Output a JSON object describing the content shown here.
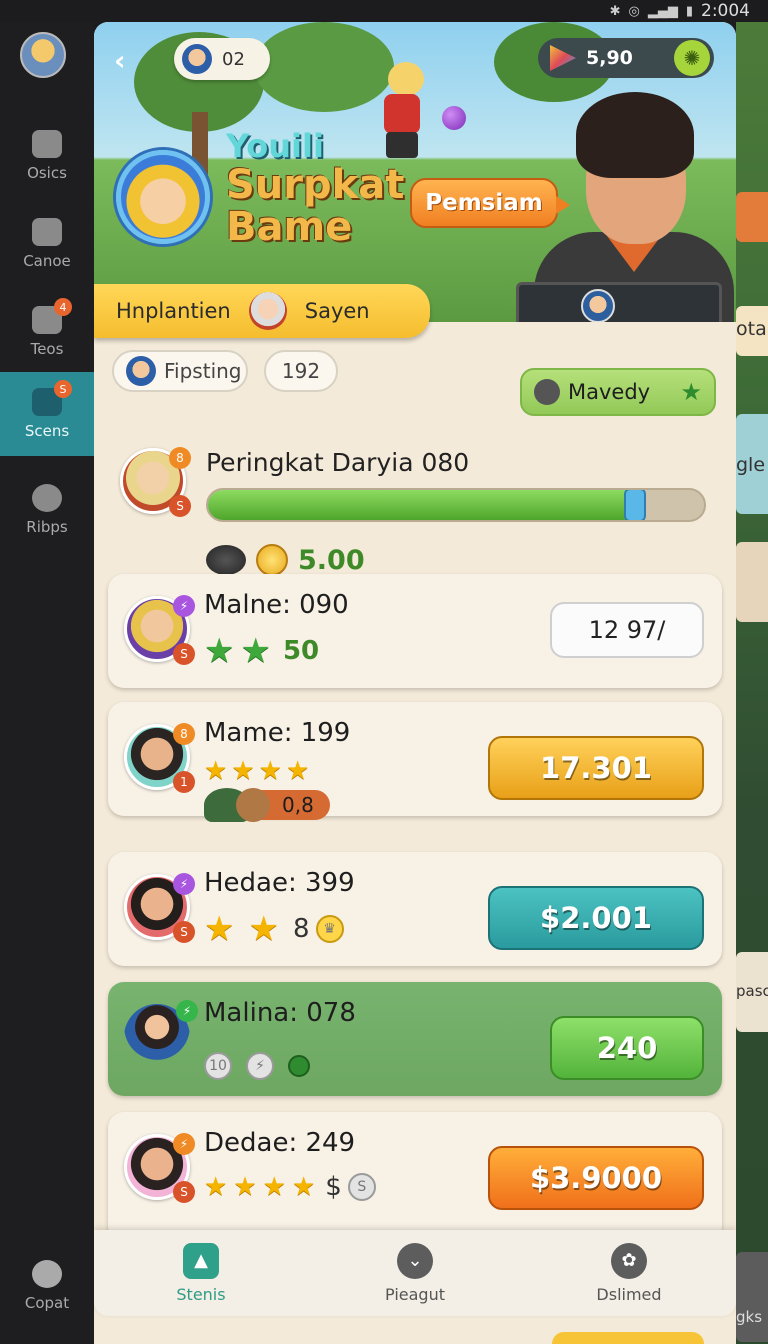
{
  "status_bar": {
    "time": "2:004"
  },
  "rail": {
    "items": [
      {
        "label": "Osics"
      },
      {
        "label": "Canoe"
      },
      {
        "label": "Teos",
        "badge": "4"
      },
      {
        "label": "Scens",
        "badge": "S",
        "active": true
      },
      {
        "label": "Ribps"
      }
    ],
    "bottom_label": "Copat"
  },
  "right_edge": {
    "fragments": [
      "otar",
      "gle",
      "pasc",
      "gks"
    ]
  },
  "hero": {
    "pill_count": "02",
    "coins": "5,90",
    "title_line1": "Youili",
    "title_line2": "Surpkat",
    "title_line3": "Bame",
    "cta": "Pemsiam",
    "ribbon_left": "Hnplantien",
    "ribbon_right": "Sayen"
  },
  "filters": {
    "chip1": "Fipsting",
    "chip2": "192",
    "chip3": "Mavedy"
  },
  "progress": {
    "title": "Peringkat Daryia 080",
    "fraction": 0.86,
    "reward": "5.00"
  },
  "rows": [
    {
      "name": "Malne: 090",
      "stars": 2,
      "extra": "50",
      "value": "12  97/",
      "style": "white"
    },
    {
      "name": "Mame: 199",
      "stars": 4,
      "extra": "0,8",
      "value": "17.301",
      "style": "gold"
    },
    {
      "name": "Hedae: 399",
      "stars": 2,
      "extra": "8",
      "value": "$2.001",
      "style": "teal"
    },
    {
      "name": "Malina: 078",
      "stars": 0,
      "extra": "",
      "value": "240",
      "style": "lime"
    },
    {
      "name": "Dedae: 249",
      "stars": 4,
      "extra": "$",
      "value": "$3.9000",
      "style": "orange"
    }
  ],
  "bottom_nav": [
    {
      "label": "Stenis",
      "active": true
    },
    {
      "label": "Pieagut"
    },
    {
      "label": "Dslimed"
    }
  ],
  "colors": {
    "accent_teal": "#2a8b95",
    "progress_green": "#4ea52b",
    "panel_bg": "#f4ead9"
  }
}
